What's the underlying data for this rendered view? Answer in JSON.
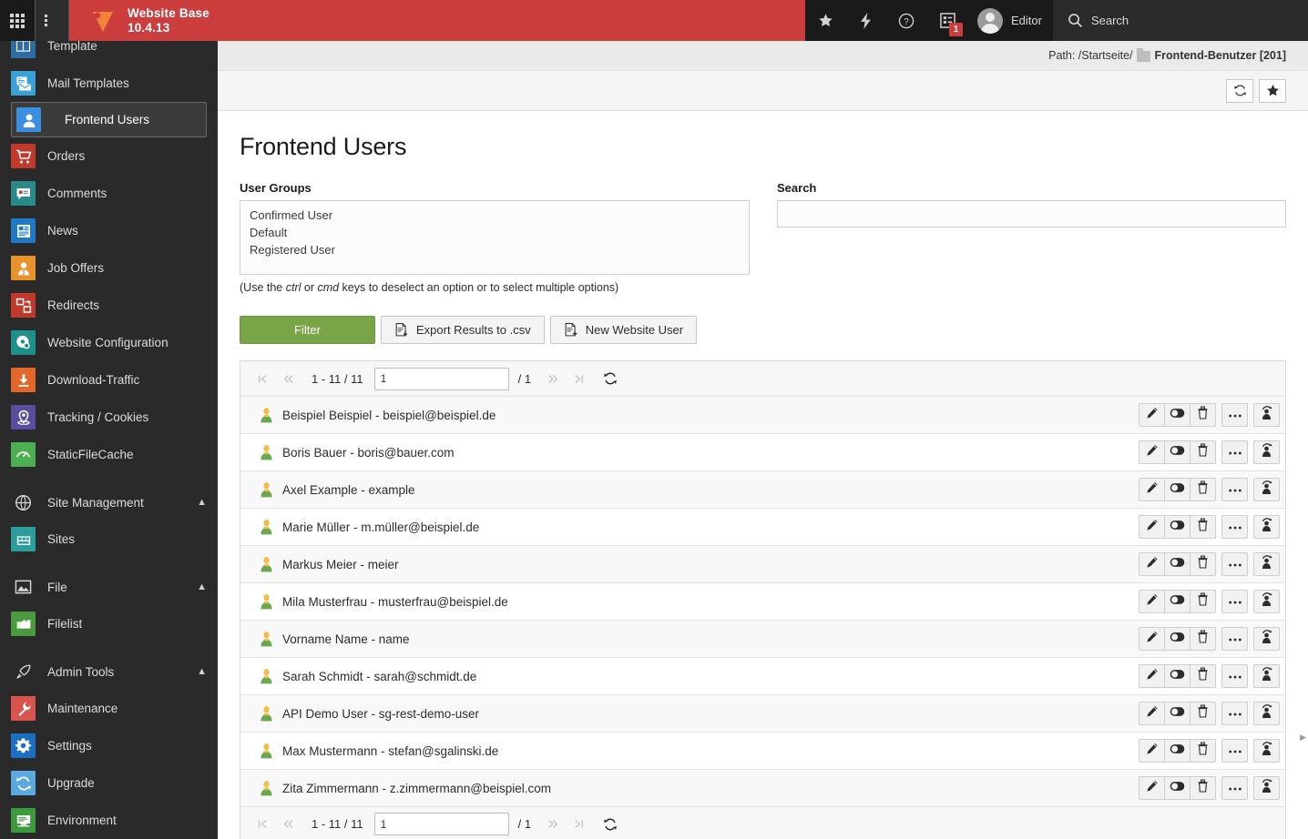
{
  "topbar": {
    "app_switcher_icon": "grid-dots-icon",
    "module_menu_icon": "list-menu-icon",
    "brand_name": "Website Base",
    "brand_version": "10.4.13",
    "logo_icon": "typo3-logo-icon",
    "items": [
      {
        "icon": "star-icon",
        "label": ""
      },
      {
        "icon": "bolt-icon",
        "label": ""
      },
      {
        "icon": "question-circle-icon",
        "label": ""
      },
      {
        "icon": "clipboard-list-icon",
        "label": "",
        "badge": "1"
      }
    ],
    "user": {
      "name": "Editor",
      "avatar_icon": "avatar-icon"
    },
    "search": {
      "icon": "search-icon",
      "label": "Search"
    }
  },
  "sidebar": {
    "items": [
      {
        "label": "Template",
        "icon": "template-icon",
        "color": "#2e6da4",
        "active": false,
        "cut": true
      },
      {
        "label": "Mail Templates",
        "icon": "mail-template-icon",
        "color": "#3ba2d8",
        "active": false
      },
      {
        "label": "Frontend Users",
        "icon": "frontend-user-icon",
        "color": "#3a8fe0",
        "active": true
      },
      {
        "label": "Orders",
        "icon": "cart-icon",
        "color": "#c0392b",
        "active": false
      },
      {
        "label": "Comments",
        "icon": "comment-icon",
        "color": "#2a8a8a",
        "active": false
      },
      {
        "label": "News",
        "icon": "news-icon",
        "color": "#1e79c7",
        "active": false
      },
      {
        "label": "Job Offers",
        "icon": "job-offers-icon",
        "color": "#e8912d",
        "active": false
      },
      {
        "label": "Redirects",
        "icon": "redirect-icon",
        "color": "#c0392b",
        "active": false
      },
      {
        "label": "Website Configuration",
        "icon": "gear-config-icon",
        "color": "#1f9089",
        "active": false
      },
      {
        "label": "Download-Traffic",
        "icon": "download-icon",
        "color": "#e2672a",
        "active": false
      },
      {
        "label": "Tracking / Cookies",
        "icon": "location-pin-icon",
        "color": "#5b4d9e",
        "active": false
      },
      {
        "label": "StaticFileCache",
        "icon": "gauge-icon",
        "color": "#4caf50",
        "active": false
      }
    ],
    "sections": [
      {
        "label": "Site Management",
        "icon": "globe-icon",
        "chevron": "chevron-up-icon",
        "items": [
          {
            "label": "Sites",
            "icon": "sites-icon",
            "color": "#2a9d9d"
          }
        ]
      },
      {
        "label": "File",
        "icon": "image-icon",
        "chevron": "chevron-up-icon",
        "items": [
          {
            "label": "Filelist",
            "icon": "filelist-icon",
            "color": "#4a9b3f"
          }
        ]
      },
      {
        "label": "Admin Tools",
        "icon": "rocket-icon",
        "chevron": "chevron-up-icon",
        "items": [
          {
            "label": "Maintenance",
            "icon": "wrench-icon",
            "color": "#d9534f"
          },
          {
            "label": "Settings",
            "icon": "gear-icon",
            "color": "#1b6ec2"
          },
          {
            "label": "Upgrade",
            "icon": "refresh-icon",
            "color": "#5aa9e0"
          },
          {
            "label": "Environment",
            "icon": "environment-icon",
            "color": "#3c9a3c"
          }
        ]
      }
    ]
  },
  "pathbar": {
    "prefix": "Path: /Startseite/",
    "folder_icon": "folder-icon",
    "current": "Frontend-Benutzer [201]"
  },
  "docheader": {
    "buttons": [
      {
        "name": "refresh-button",
        "icon": "refresh-icon"
      },
      {
        "name": "bookmark-button",
        "icon": "star-icon"
      }
    ]
  },
  "main": {
    "page_title": "Frontend Users",
    "user_groups": {
      "label": "User Groups",
      "options": [
        "Confirmed User",
        "Default",
        "Registered User"
      ],
      "hint_before": "(Use the ",
      "hint_em1": "ctrl",
      "hint_mid": " or ",
      "hint_em2": "cmd",
      "hint_after": " keys to deselect an option or to select multiple options)"
    },
    "search": {
      "label": "Search",
      "value": "",
      "placeholder": ""
    },
    "buttons": {
      "filter": "Filter",
      "export": "Export Results to .csv",
      "export_icon": "export-csv-icon",
      "new_user": "New Website User",
      "new_user_icon": "new-document-icon"
    }
  },
  "pager": {
    "first_icon": "first-page-icon",
    "prev_icon": "prev-page-icon",
    "range": "1 - 11 / 11",
    "page_value": "1",
    "total": "/ 1",
    "next_icon": "next-page-icon",
    "last_icon": "last-page-icon",
    "reload_icon": "reload-icon"
  },
  "table": {
    "row_icon": "frontend-user-record-icon",
    "actions": [
      {
        "name": "edit-button",
        "icon": "pencil-icon"
      },
      {
        "name": "disable-button",
        "icon": "toggle-icon"
      },
      {
        "name": "delete-button",
        "icon": "trash-icon"
      },
      {
        "name": "more-button",
        "icon": "ellipsis-icon"
      },
      {
        "name": "switch-user-button",
        "icon": "switch-user-icon"
      }
    ],
    "rows": [
      {
        "label": "Beispiel Beispiel - beispiel@beispiel.de"
      },
      {
        "label": "Boris Bauer - boris@bauer.com"
      },
      {
        "label": "Axel Example - example"
      },
      {
        "label": "Marie Müller - m.müller@beispiel.de"
      },
      {
        "label": "Markus Meier - meier"
      },
      {
        "label": "Mila Musterfrau - musterfrau@beispiel.de"
      },
      {
        "label": "Vorname Name - name"
      },
      {
        "label": "Sarah Schmidt - sarah@schmidt.de"
      },
      {
        "label": "API Demo User - sg-rest-demo-user"
      },
      {
        "label": "Max Mustermann - stefan@sgalinski.de"
      },
      {
        "label": "Zita Zimmermann - z.zimmermann@beispiel.com"
      }
    ]
  },
  "colors": {
    "brand_red": "#cc3e3e",
    "topbar_dark": "#1a1a1a",
    "sidebar_dark": "#2a2a2a",
    "filter_green": "#79a548"
  }
}
